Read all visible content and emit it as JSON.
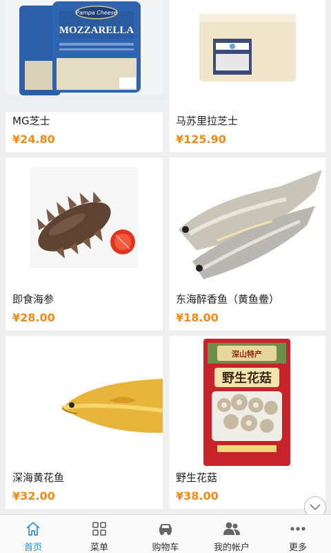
{
  "products": [
    {
      "name": "MG芝士",
      "price": "¥24.80"
    },
    {
      "name": "马苏里拉芝士",
      "price": "¥125.90"
    },
    {
      "name": "即食海参",
      "price": "¥28.00"
    },
    {
      "name": "东海醉香鱼（黄鱼鲞）",
      "price": "¥18.00"
    },
    {
      "name": "深海黄花鱼",
      "price": "¥32.00"
    },
    {
      "name": "野生花菇",
      "price": "¥38.00"
    }
  ],
  "product_images": {
    "mozzarella_brand": "Pampa Cheese",
    "mozzarella_label": "MOZZARELLA",
    "mushroom_pack_title": "野生花菇",
    "mushroom_pack_subtitle": "深山特产"
  },
  "tabbar": {
    "items": [
      {
        "label": "首页",
        "icon": "home-icon",
        "active": true
      },
      {
        "label": "菜单",
        "icon": "menu-grid-icon",
        "active": false
      },
      {
        "label": "购物车",
        "icon": "cart-icon",
        "active": false
      },
      {
        "label": "我的帐户",
        "icon": "account-icon",
        "active": false
      },
      {
        "label": "更多",
        "icon": "more-icon",
        "active": false
      }
    ]
  },
  "colors": {
    "price": "#f08a1a",
    "active_tab": "#2b8fe0",
    "background": "#efefef"
  }
}
